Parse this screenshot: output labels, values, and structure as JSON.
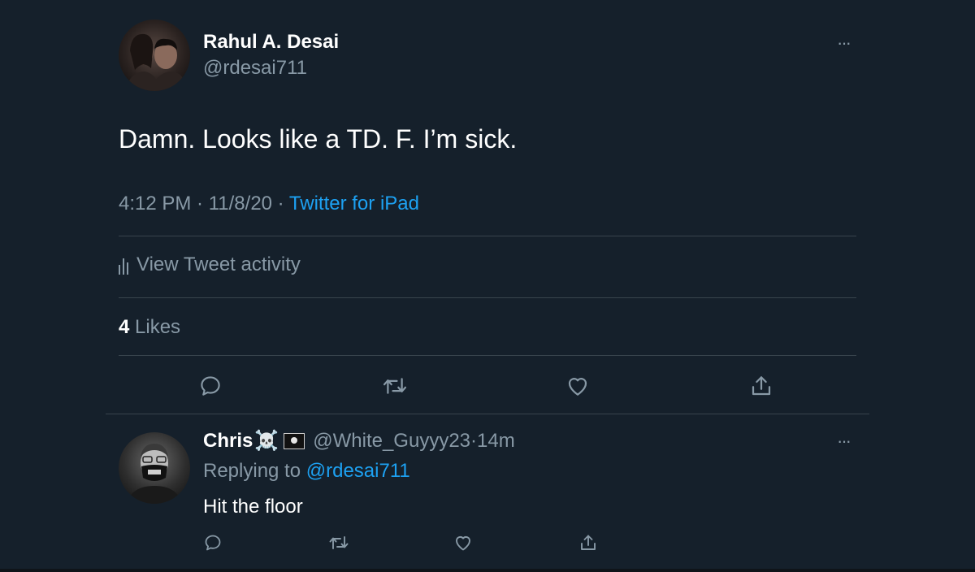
{
  "tweet": {
    "author_name": "Rahul A. Desai",
    "author_handle": "@rdesai711",
    "avatar_icon": "profile-photo-couple",
    "text": "Damn. Looks like a TD. F. I’m sick.",
    "time": "4:12 PM",
    "separator": " · ",
    "date": "11/8/20",
    "source": "Twitter for iPad",
    "activity_label": "View Tweet activity",
    "likes_count": "4",
    "likes_label": "Likes",
    "more_icon": "···",
    "actions": [
      "reply-icon",
      "retweet-icon",
      "like-icon",
      "share-icon"
    ]
  },
  "reply": {
    "author_name": "Chris",
    "emoji": "☠️",
    "flag_icon": "pirate-flag-icon",
    "author_handle": "@White_Guyyy23",
    "separator": " · ",
    "time_ago": "14m",
    "replying_label": "Replying to ",
    "replying_to": "@rdesai711",
    "text": "Hit the floor",
    "avatar_icon": "profile-photo-masked-man",
    "more_icon": "···",
    "actions": [
      "reply-icon",
      "retweet-icon",
      "like-icon",
      "share-icon"
    ]
  },
  "colors": {
    "background": "#15202b",
    "text_primary": "#ffffff",
    "text_secondary": "#8899a6",
    "accent": "#1da1f2",
    "divider": "#38444d"
  }
}
